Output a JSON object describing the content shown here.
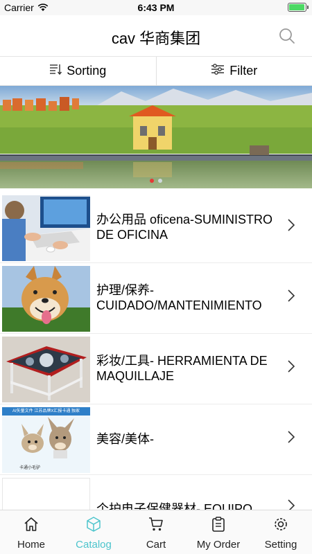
{
  "status_bar": {
    "carrier": "Carrier",
    "time": "6:43 PM",
    "battery_level": 0.95,
    "battery_color": "#4cd964"
  },
  "header": {
    "title": "cav 华商集团"
  },
  "sortbar": {
    "sorting_label": "Sorting",
    "filter_label": "Filter"
  },
  "banner": {
    "slide_count": 2,
    "active_slide": 1,
    "active_dot_color": "#e53935"
  },
  "categories": [
    {
      "label": "办公用品 oficena-SUMINISTRO DE OFICINA"
    },
    {
      "label": "护理/保养-CUIDADO/MANTENIMIENTO"
    },
    {
      "label": "彩妆/工具- HERRAMIENTA DE MAQUILLAJE"
    },
    {
      "label": "美容/美体-",
      "thumb_banner": "AI矢量文件 江苏品牌X汇报卡通 独家",
      "thumb_caption": "卡通小毛驴"
    },
    {
      "label": "个护电子保健器材- EQUIPO"
    }
  ],
  "tabbar": {
    "accent_color": "#4cc4cc",
    "tabs": [
      {
        "label": "Home",
        "icon": "home-icon"
      },
      {
        "label": "Catalog",
        "icon": "cube-icon",
        "active": true
      },
      {
        "label": "Cart",
        "icon": "cart-icon"
      },
      {
        "label": "My Order",
        "icon": "order-icon"
      },
      {
        "label": "Setting",
        "icon": "gear-icon"
      }
    ]
  }
}
